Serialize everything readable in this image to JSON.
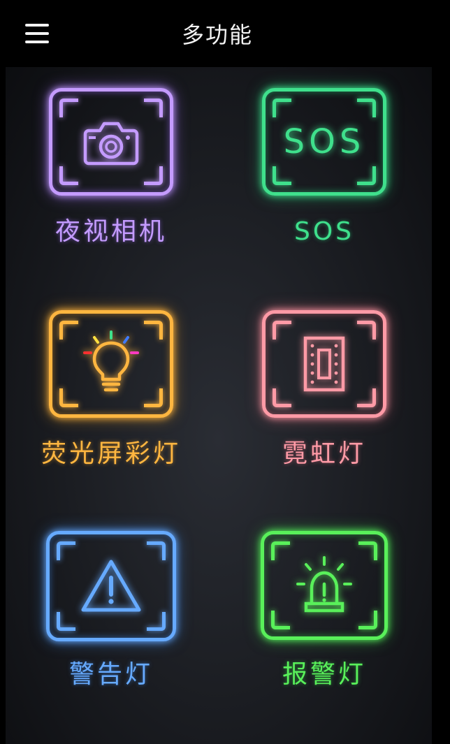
{
  "header": {
    "title": "多功能",
    "menu_icon": "hamburger-menu-icon"
  },
  "features": [
    {
      "label": "夜视相机",
      "icon": "camera-icon",
      "color": "#c49bff"
    },
    {
      "label": "SOS",
      "icon": "sos-icon",
      "icon_text": "SOS",
      "color": "#3fe08c"
    },
    {
      "label": "荧光屏彩灯",
      "icon": "lightbulb-icon",
      "color": "#ffb640"
    },
    {
      "label": "霓虹灯",
      "icon": "neon-panel-icon",
      "color": "#ff9aa6"
    },
    {
      "label": "警告灯",
      "icon": "warning-triangle-icon",
      "color": "#66aaff"
    },
    {
      "label": "报警灯",
      "icon": "siren-alarm-icon",
      "color": "#59f05a"
    }
  ]
}
